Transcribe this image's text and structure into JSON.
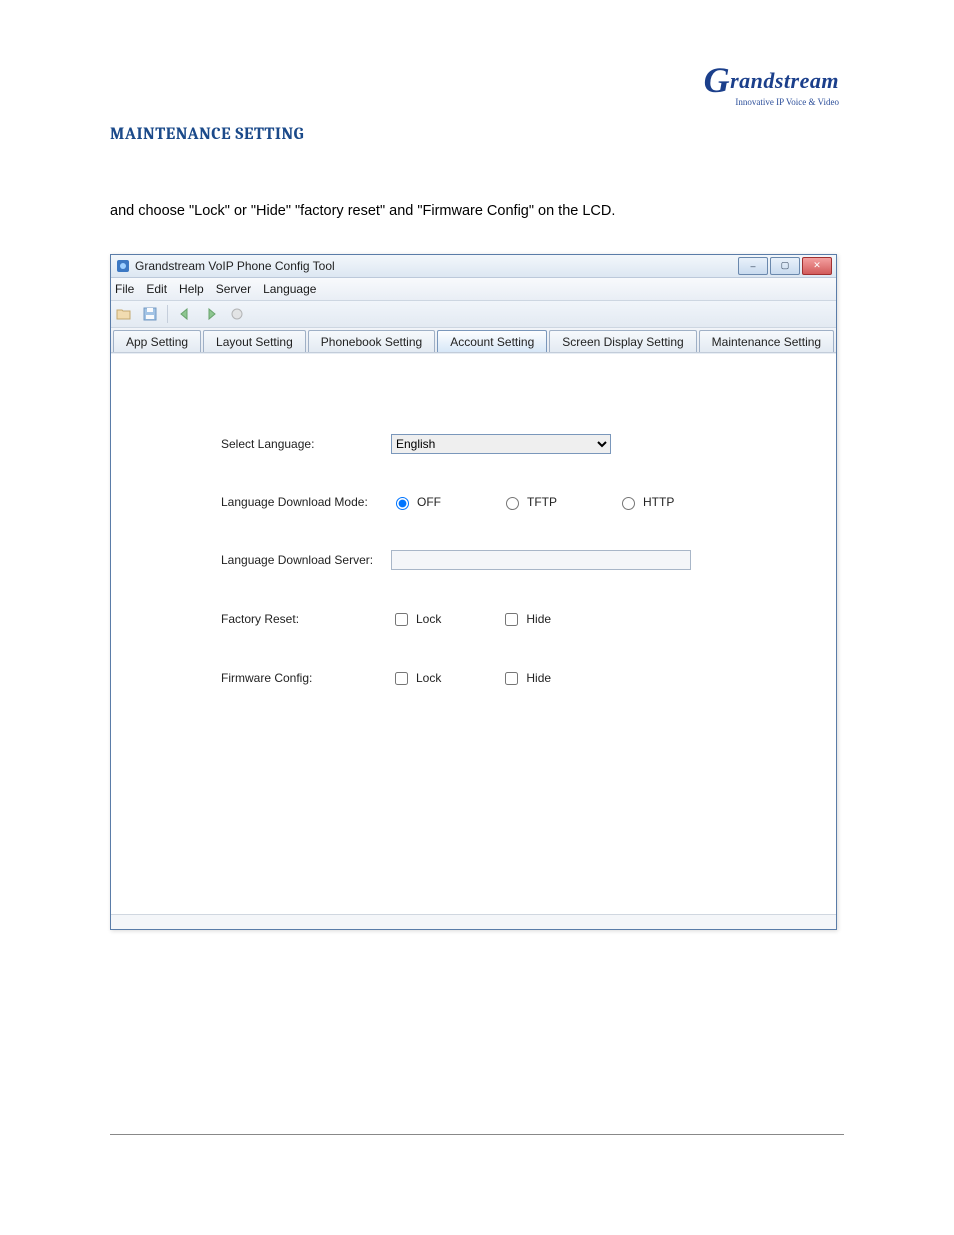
{
  "logo": {
    "brand_prefix": "G",
    "brand_rest": "randstream",
    "tagline": "Innovative IP Voice & Video"
  },
  "section_title": "MAINTENANCE SETTING",
  "body_text": "and choose \"Lock\" or \"Hide\" \"factory reset\" and \"Firmware Config\" on the LCD.",
  "window": {
    "title": "Grandstream VoIP Phone Config Tool",
    "controls": {
      "minimize": "–",
      "maximize": "▢",
      "close": "✕"
    }
  },
  "menubar": [
    "File",
    "Edit",
    "Help",
    "Server",
    "Language"
  ],
  "tabs": [
    {
      "label": "App Setting",
      "active": false
    },
    {
      "label": "Layout Setting",
      "active": false
    },
    {
      "label": "Phonebook Setting",
      "active": false
    },
    {
      "label": "Account Setting",
      "active": true
    },
    {
      "label": "Screen Display Setting",
      "active": false
    },
    {
      "label": "Maintenance Setting",
      "active": false
    }
  ],
  "form": {
    "select_language": {
      "label": "Select Language:",
      "value": "English"
    },
    "download_mode": {
      "label": "Language Download Mode:",
      "options": [
        "OFF",
        "TFTP",
        "HTTP"
      ],
      "selected": "OFF"
    },
    "download_server": {
      "label": "Language Download Server:",
      "value": ""
    },
    "factory_reset": {
      "label": "Factory Reset:",
      "lock": {
        "label": "Lock",
        "checked": false
      },
      "hide": {
        "label": "Hide",
        "checked": false
      }
    },
    "firmware_config": {
      "label": "Firmware Config:",
      "lock": {
        "label": "Lock",
        "checked": false
      },
      "hide": {
        "label": "Hide",
        "checked": false
      }
    }
  }
}
